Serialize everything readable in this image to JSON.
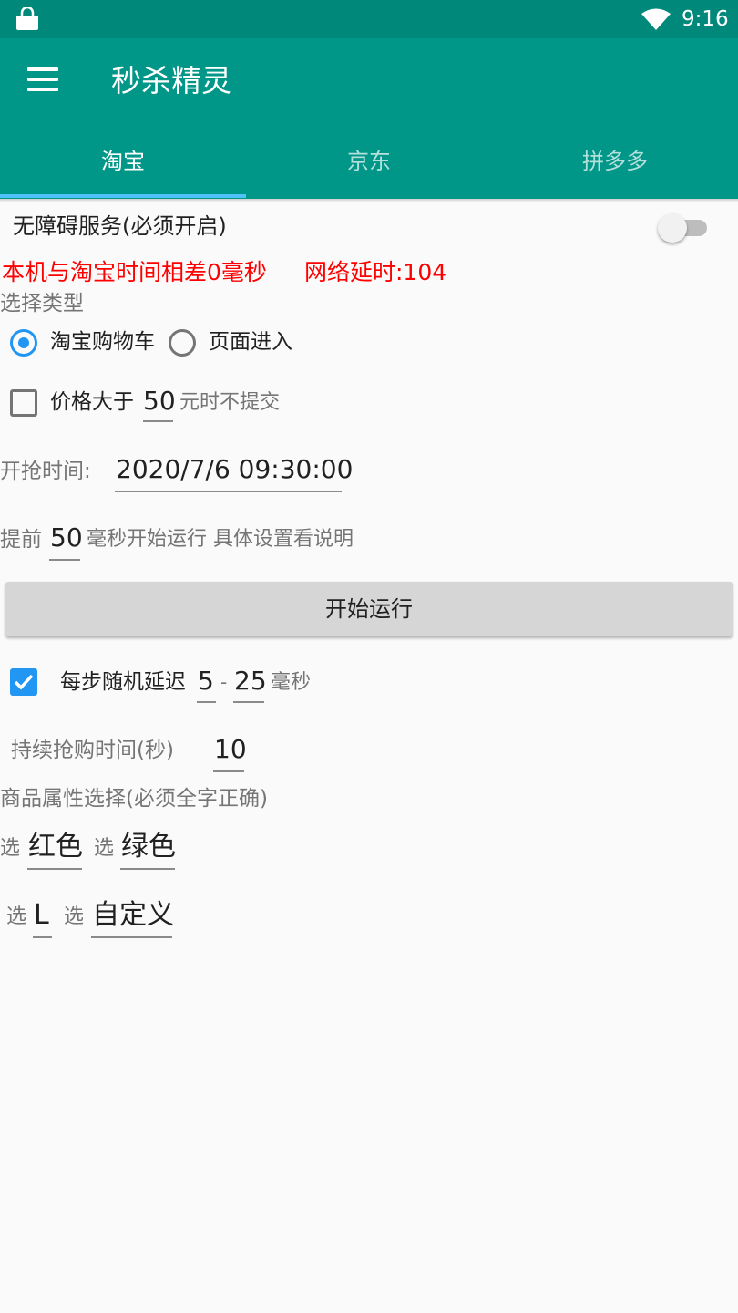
{
  "status_bar": {
    "time": "9:16",
    "icons": [
      "shopping-bag-icon",
      "wifi-icon"
    ]
  },
  "toolbar": {
    "title": "秒杀精灵",
    "menu_icon": "hamburger-menu-icon"
  },
  "tabs": [
    {
      "label": "淘宝",
      "active": true
    },
    {
      "label": "京东",
      "active": false
    },
    {
      "label": "拼多多",
      "active": false
    }
  ],
  "accessibility": {
    "label": "无障碍服务(必须开启)",
    "enabled": false
  },
  "status_line": {
    "time_diff": "本机与淘宝时间相差0毫秒",
    "latency": "网络延时:104"
  },
  "type_select": {
    "label": "选择类型",
    "options": [
      {
        "label": "淘宝购物车",
        "selected": true
      },
      {
        "label": "页面进入",
        "selected": false
      }
    ]
  },
  "price_limit": {
    "checked": false,
    "prefix": "价格大于",
    "value": "50",
    "suffix": "元时不提交"
  },
  "start_time": {
    "label": "开抢时间:",
    "value": "2020/7/6 09:30:00"
  },
  "advance": {
    "prefix": "提前",
    "value": "50",
    "suffix": "毫秒开始运行 具体设置看说明"
  },
  "start_button": {
    "label": "开始运行"
  },
  "random_delay": {
    "checked": true,
    "label": "每步随机延迟",
    "min": "5",
    "separator": "-",
    "max": "25",
    "unit": "毫秒"
  },
  "duration": {
    "label": "持续抢购时间(秒)",
    "value": "10"
  },
  "attributes": {
    "label": "商品属性选择(必须全字正确)",
    "select_word": "选",
    "values": [
      "红色",
      "绿色",
      "L",
      "自定义"
    ]
  },
  "colors": {
    "primary": "#009688",
    "status_bar": "#00897b",
    "accent": "#2196f3",
    "tab_indicator": "#4fc3f7",
    "alert": "#ff0000"
  }
}
